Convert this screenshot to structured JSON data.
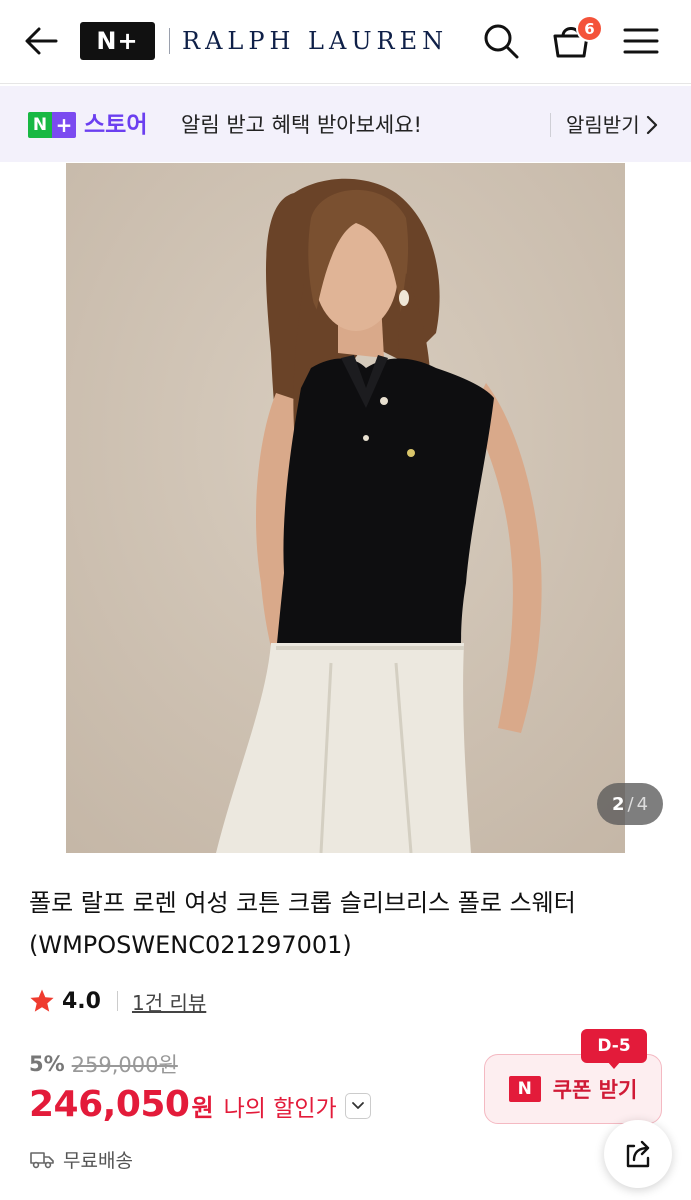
{
  "header": {
    "logo_text": "N+",
    "brand_name": "RALPH LAUREN",
    "cart_count": "6",
    "icons": [
      "arrow-left-icon",
      "search-icon",
      "shopping-basket-icon",
      "hamburger-menu-icon"
    ]
  },
  "notice": {
    "store_n": "N",
    "store_plus": "+",
    "store_name": "스토어",
    "message": "알림 받고 혜택 받아보세요!",
    "action_label": "알림받기"
  },
  "gallery": {
    "current": "2",
    "separator": "/",
    "total": "4"
  },
  "product": {
    "title": "폴로 랄프 로렌 여성 코튼 크롭 슬리브리스 폴로 스웨터(WMPOSWENC021297001)",
    "rating": "4.0",
    "review_count_label": "1건 리뷰",
    "discount_rate": "5%",
    "original_price": "259,000원",
    "sale_price": "246,050",
    "currency": "원",
    "my_price_label": "나의 할인가",
    "shipping": "무료배송"
  },
  "coupon": {
    "dday": "D-5",
    "n_mark": "N",
    "label": "쿠폰 받기"
  },
  "colors": {
    "accent_red": "#e31b3a",
    "brand_navy": "#0f2048",
    "store_green": "#18b843",
    "store_purple": "#7b4bf0",
    "badge_orange": "#f4533a"
  }
}
